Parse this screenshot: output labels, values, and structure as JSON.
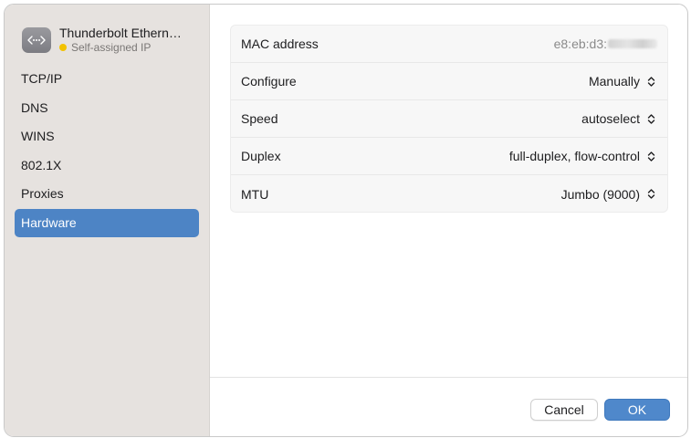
{
  "sidebar": {
    "interface": {
      "icon": "network-interface-icon",
      "name": "Thunderbolt Ethern…",
      "status": "Self-assigned IP",
      "status_color": "#f2c200"
    },
    "items": [
      {
        "label": "TCP/IP"
      },
      {
        "label": "DNS"
      },
      {
        "label": "WINS"
      },
      {
        "label": "802.1X"
      },
      {
        "label": "Proxies"
      },
      {
        "label": "Hardware",
        "selected": true
      }
    ]
  },
  "hardware": {
    "mac_label": "MAC address",
    "mac_value": "e8:eb:d3:",
    "configure_label": "Configure",
    "configure_value": "Manually",
    "speed_label": "Speed",
    "speed_value": "autoselect",
    "duplex_label": "Duplex",
    "duplex_value": "full-duplex, flow-control",
    "mtu_label": "MTU",
    "mtu_value": "Jumbo (9000)"
  },
  "footer": {
    "cancel_label": "Cancel",
    "ok_label": "OK"
  },
  "colors": {
    "accent": "#4d84c5",
    "sidebar_bg": "#e6e2df"
  }
}
